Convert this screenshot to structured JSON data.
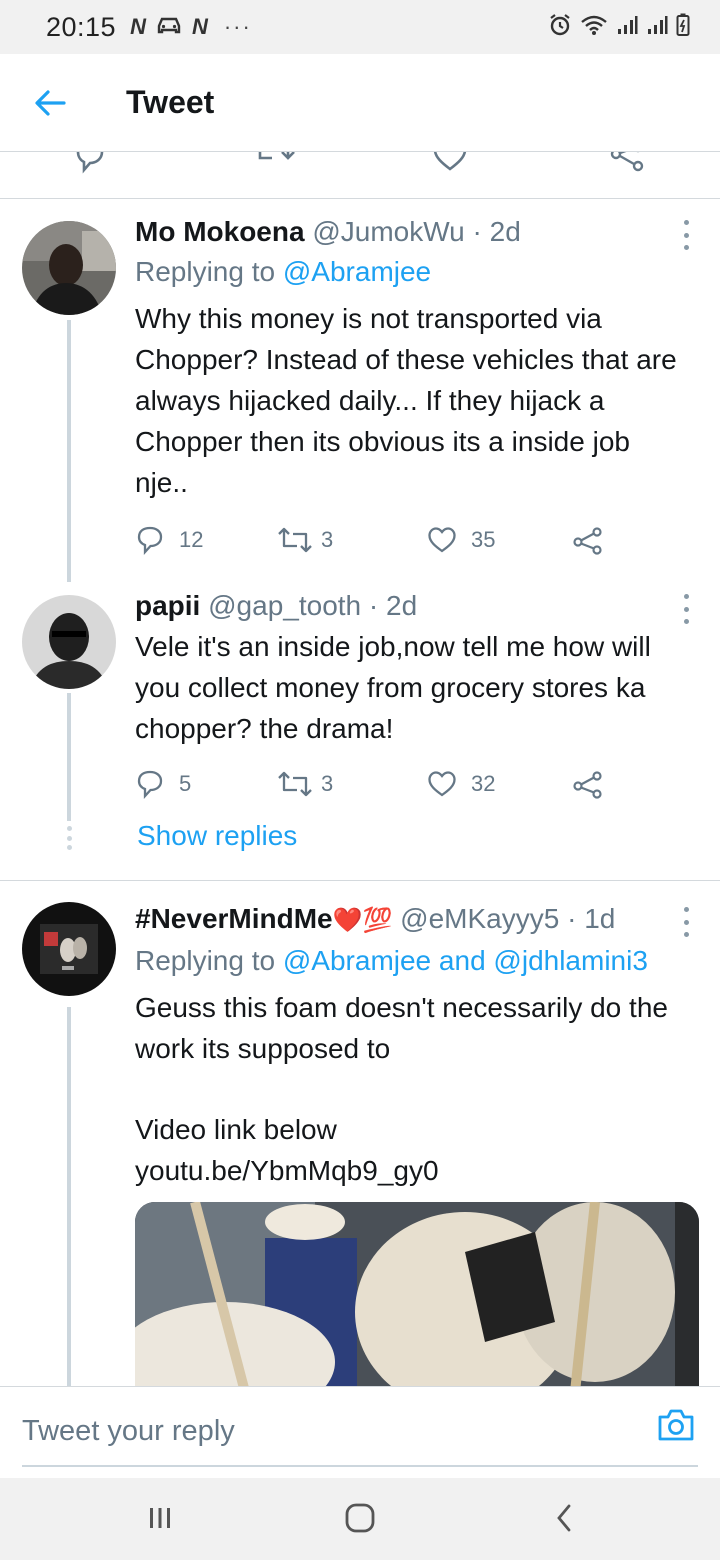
{
  "status_bar": {
    "time": "20:15",
    "left_icons": [
      "N",
      "car-icon",
      "N"
    ],
    "more": "···"
  },
  "header": {
    "title": "Tweet"
  },
  "colors": {
    "accent": "#1da1f2",
    "text_primary": "#14171a",
    "text_secondary": "#657786",
    "border": "#d4d9dd",
    "like_red": "#e0245e"
  },
  "tweets": [
    {
      "name": "Mo Mokoena",
      "handle": "@JumokWu",
      "time": "2d",
      "replying_prefix": "Replying to",
      "replying_to": "@Abramjee",
      "text": "Why this money is not transported via Chopper? Instead of these vehicles that are always hijacked daily... If they hijack a Chopper then its obvious its a inside job nje..",
      "replies": "12",
      "retweets": "3",
      "likes": "35"
    },
    {
      "name": "papii",
      "handle": "@gap_tooth",
      "time": "2d",
      "text": "Vele it's an inside job,now tell me how will you collect money from grocery stores ka chopper? the drama!",
      "replies": "5",
      "retweets": "3",
      "likes": "32",
      "show_replies": "Show replies"
    },
    {
      "name": "#NeverMindMe",
      "name_emoji": "❤️💯",
      "handle": "@eMKayyy5",
      "time": "1d",
      "replying_prefix": "Replying to",
      "replying_to_1": "@Abramjee",
      "replying_and": "and",
      "replying_to_2": "@jdhlamini3",
      "text_line1": "Geuss this foam doesn't necessarily do the work its supposed to",
      "text_line2": "Video link below",
      "link": "youtu.be/YbmMqb9_gy0"
    }
  ],
  "reply_bar": {
    "placeholder": "Tweet your reply"
  }
}
